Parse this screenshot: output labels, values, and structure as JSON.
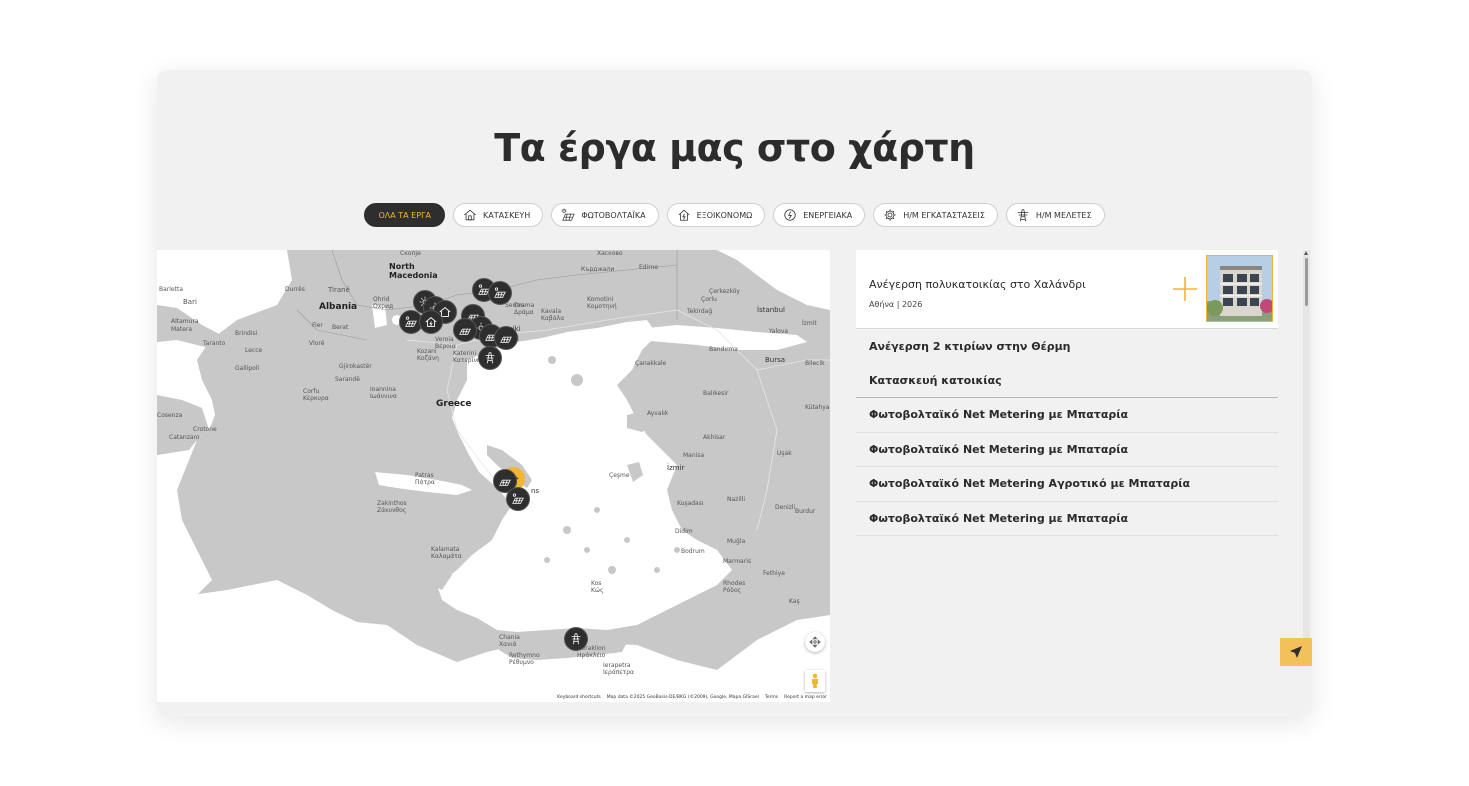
{
  "page": {
    "title": "Τα έργα μας στο χάρτη"
  },
  "filters": [
    {
      "label": "ΟΛΑ ΤΑ ΕΡΓΑ",
      "icon": "none",
      "active": true
    },
    {
      "label": "ΚΑΤΑΣΚΕΥΗ",
      "icon": "house-icon",
      "active": false
    },
    {
      "label": "ΦΩΤΟΒΟΛΤΑΪΚΑ",
      "icon": "solar-panel-icon",
      "active": false
    },
    {
      "label": "ΕΞΟΙΚΟΝΟΜΩ",
      "icon": "home-energy-icon",
      "active": false
    },
    {
      "label": "ΕΝΕΡΓΕΙΑΚΑ",
      "icon": "leaf-bolt-icon",
      "active": false
    },
    {
      "label": "Η/Μ ΕΓΚΑΤΑΣΤΑΣΕΙΣ",
      "icon": "gear-icon",
      "active": false
    },
    {
      "label": "Η/Μ ΜΕΛΕΤΕΣ",
      "icon": "pylon-icon",
      "active": false
    }
  ],
  "map": {
    "labels": {
      "skopje": "Скопје",
      "north_macedonia": "North\nMacedonia",
      "albania": "Albania",
      "tirane": "Tiranë",
      "durres": "Durrës",
      "barletta": "Barletta",
      "bari": "Bari",
      "matera": "Matera",
      "altamura": "Altamura",
      "taranto": "Taranto",
      "brindisi": "Brindisi",
      "lecce": "Lecce",
      "gallipoli": "Gallipoli",
      "cosenza": "Cosenza",
      "catanzaro": "Catanzaro",
      "crotone": "Crotone",
      "ohrid": "Ohrid\nОхрид",
      "berat": "Berat",
      "fier": "Fier",
      "vlore": "Vlorë",
      "gjirokaster": "Gjirokastër",
      "sarande": "Sarandë",
      "corfu": "Corfu\nΚέρκυρα",
      "ioannina": "Ioannina\nΙωάννινα",
      "greece": "Greece",
      "kozani": "Kozani\nΚοζάνη",
      "veroia": "Veroia\nΒέροια",
      "katerini": "Katerini\nΚατερίνη",
      "thessaloniki": "oniki\nνίκη",
      "serres": "Serres",
      "drama": "Drama\nΔράμα",
      "kavala": "Kavala\nΚαβάλα",
      "komotini": "Komotini\nΚομοτηνή",
      "kardzhali": "Кърджали",
      "haskovo": "Хасково",
      "edirne": "Edirne",
      "corlu": "Çorlu",
      "tekirdag": "Tekirdağ",
      "cerkezkoy": "Çerkezköy",
      "istanbul": "İstanbul",
      "izmit": "İzmit",
      "yalova": "Yalova",
      "bursa": "Bursa",
      "bilecik": "Bilecik",
      "bandirma": "Bandırma",
      "canakkale": "Çanakkale",
      "balikesir": "Balıkesir",
      "kutahya": "Kütahya",
      "ayvalik": "Ayvalık",
      "akhisar": "Akhisar",
      "usak": "Uşak",
      "manisa": "Manisa",
      "izmir": "İzmir",
      "cesme": "Çeşme",
      "aydin": "Aydın",
      "kusadasi": "Kuşadası",
      "nazilli": "Nazilli",
      "denizli": "Denizli",
      "burdur": "Burdur",
      "didim": "Didim",
      "mugla": "Muğla",
      "bodrum": "Bodrum",
      "marmaris": "Marmaris",
      "fethiye": "Fethiye",
      "kas": "Kaş",
      "rhodes": "Rhodes\nΡόδος",
      "kos": "Kos\nΚώς",
      "patras": "Patras\nΠάτρα",
      "zakinthos": "Zakinthos\nΖάκυνθος",
      "athens": "ns",
      "kalamata": "Kalamata\nΚαλαμάτα",
      "chania": "Chania\nΧανιά",
      "heraklion": "Heraklion\nΗράκλειο",
      "rethymno": "Rethymno\nΡέθυμνο",
      "ierapetra": "Ierapetra\nΙεράπετρα"
    },
    "attribution": [
      "Keyboard shortcuts",
      "Map data ©2025 GeoBasis-DE/BKG (©2009), Google, Mapa GISrael",
      "Terms",
      "Report a map error"
    ]
  },
  "projects": {
    "featured": {
      "title": "Ανέγερση πολυκατοικίας στο Χαλάνδρι",
      "meta": "Αθήνα | 2026"
    },
    "items": [
      "Ανέγερση 2 κτιρίων στην Θέρμη",
      "Κατασκευή κατοικίας",
      "Φωτοβολταϊκό Net Metering με Μπαταρία",
      "Φωτοβολταϊκό Net Metering με Μπαταρία",
      "Φωτοβολταϊκό Net Metering Αγροτικό με Μπαταρία",
      "Φωτοβολταϊκό Net Metering με Μπαταρία"
    ]
  },
  "colors": {
    "accent": "#f2b632",
    "dark": "#2e2e2e",
    "map_land": "#c8c8c8",
    "map_sea": "#ffffff"
  }
}
